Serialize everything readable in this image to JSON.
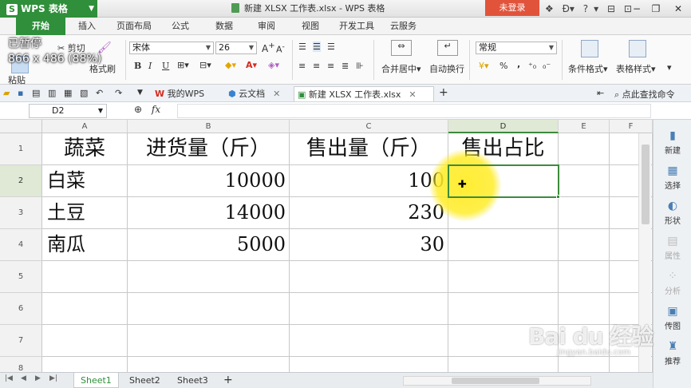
{
  "titlebar": {
    "app_name": "WPS 表格",
    "app_letter": "S",
    "doc_title": "新建 XLSX 工作表.xlsx - WPS 表格",
    "login_label": "未登录",
    "icons": [
      "shirt-icon",
      "d-icon",
      "help-icon",
      "minimize-icon",
      "skin-icon",
      "window-minimize-icon",
      "window-restore-icon",
      "window-close-icon"
    ],
    "help_label": "?",
    "minimize_label": "−",
    "restore_label": "❐",
    "close_label": "✕"
  },
  "menu": {
    "tabs": [
      "开始",
      "插入",
      "页面布局",
      "公式",
      "数据",
      "审阅",
      "视图",
      "开发工具",
      "云服务"
    ],
    "active": "开始"
  },
  "ribbon": {
    "cut_label": "剪切",
    "paste_label": "粘贴",
    "format_painter_label": "格式刷",
    "font_name": "宋体",
    "font_size": "26",
    "number_format": "常规",
    "merge_label": "合并居中",
    "wrap_label": "自动换行",
    "conditional_label": "条件格式",
    "table_style_label": "表格样式",
    "bold": "B",
    "italic": "I",
    "underline": "U",
    "percent": "%",
    "comma": ","
  },
  "overlay": {
    "status": "已暂停",
    "resolution": "866 x 486 (88%)"
  },
  "doctabs": {
    "tabs": [
      {
        "label": "我的WPS",
        "icon": "wps-logo-icon"
      },
      {
        "label": "云文档",
        "icon": "cloud-doc-icon"
      },
      {
        "label": "新建 XLSX 工作表.xlsx",
        "icon": "spreadsheet-icon"
      }
    ],
    "active": 2,
    "search_label": "点此查找命令",
    "add_label": "+"
  },
  "formula": {
    "namebox": "D2",
    "fx_label": "fx",
    "value": ""
  },
  "sheet": {
    "columns": [
      "A",
      "B",
      "C",
      "D",
      "E",
      "F"
    ],
    "rows": [
      "1",
      "2",
      "3",
      "4",
      "5",
      "6",
      "7",
      "8"
    ],
    "selected_col": "D",
    "selected_row": "2",
    "cells": [
      [
        "蔬菜",
        "进货量（斤）",
        "售出量（斤）",
        "售出占比",
        "",
        ""
      ],
      [
        "白菜",
        "10000",
        "100",
        "",
        "",
        ""
      ],
      [
        "土豆",
        "14000",
        "230",
        "",
        "",
        ""
      ],
      [
        "南瓜",
        "5000",
        "30",
        "",
        "",
        ""
      ]
    ]
  },
  "sheetbar": {
    "tabs": [
      "Sheet1",
      "Sheet2",
      "Sheet3"
    ],
    "active": "Sheet1",
    "add_label": "+"
  },
  "rightpanel": {
    "items": [
      {
        "label": "新建",
        "icon": "new-file-icon",
        "enabled": true
      },
      {
        "label": "选择",
        "icon": "select-icon",
        "enabled": true
      },
      {
        "label": "形状",
        "icon": "shape-icon",
        "enabled": true
      },
      {
        "label": "属性",
        "icon": "properties-icon",
        "enabled": false
      },
      {
        "label": "分析",
        "icon": "analysis-icon",
        "enabled": false
      },
      {
        "label": "传图",
        "icon": "upload-image-icon",
        "enabled": true
      },
      {
        "label": "推荐",
        "icon": "recommend-icon",
        "enabled": true
      }
    ]
  },
  "watermark": {
    "brand": "Bai du 经验",
    "url": "jingyan.baidu.com"
  },
  "colors": {
    "accent": "#2f8f3a",
    "login": "#e1533b",
    "selection": "#3c8b3c",
    "highlight": "#ffec28"
  }
}
